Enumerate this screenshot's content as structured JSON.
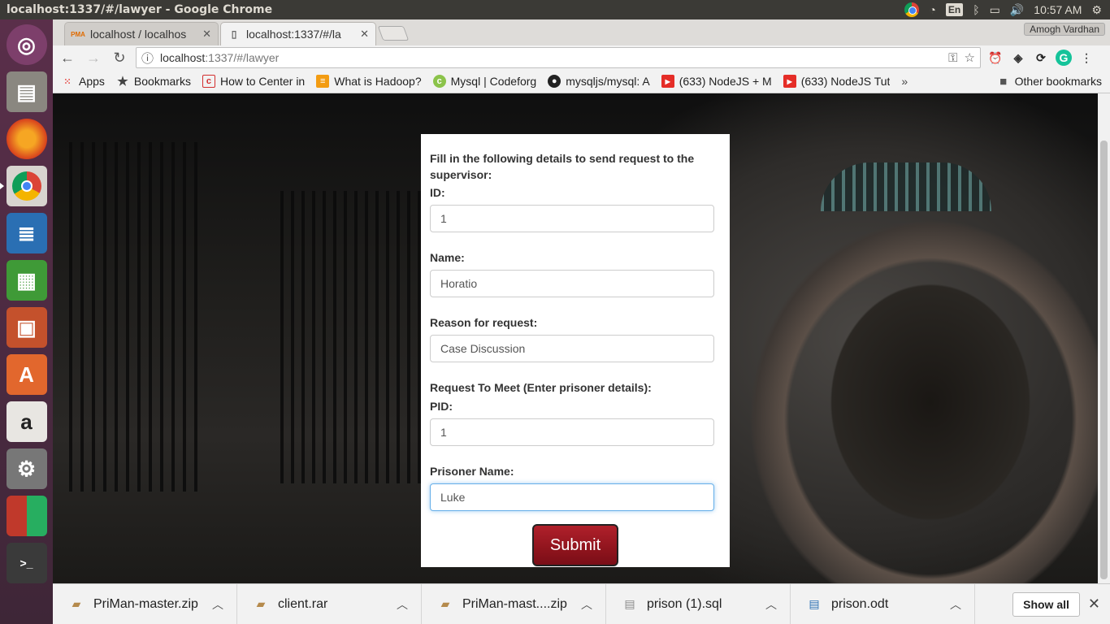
{
  "window": {
    "title": "localhost:1337/#/lawyer - Google Chrome"
  },
  "tray": {
    "lang": "En",
    "time": "10:57 AM"
  },
  "launcher": {
    "items": [
      "ubuntu-dash",
      "files",
      "firefox",
      "chrome",
      "writer",
      "calc",
      "impress",
      "software-center",
      "amazon",
      "system-settings",
      "workspace-switcher",
      "terminal"
    ]
  },
  "tabs": [
    {
      "title": "localhost / localhos",
      "favicon": "PMA"
    },
    {
      "title": "localhost:1337/#/la"
    }
  ],
  "profile": {
    "name": "Amogh Vardhan"
  },
  "omnibox": {
    "host": "localhost",
    "path": ":1337/#/lawyer"
  },
  "bookmarks": {
    "items": [
      {
        "label": "Apps",
        "icon": "apps-grid-icon"
      },
      {
        "label": "Bookmarks",
        "icon": "star-icon"
      },
      {
        "label": "How to Center in",
        "icon": "c-icon"
      },
      {
        "label": "What is Hadoop?",
        "icon": "hadoop-icon"
      },
      {
        "label": "Mysql | Codeforg",
        "icon": "codeforge-icon"
      },
      {
        "label": "mysqljs/mysql: A",
        "icon": "github-icon"
      },
      {
        "label": "(633) NodeJS + M",
        "icon": "youtube-icon"
      },
      {
        "label": "(633) NodeJS Tut",
        "icon": "youtube-icon"
      }
    ],
    "overflow": "»",
    "other": "Other bookmarks"
  },
  "form": {
    "heading": "Fill in the following details to send request to the supervisor:",
    "id_label": "ID:",
    "id_value": "1",
    "name_label": "Name:",
    "name_value": "Horatio",
    "reason_label": "Reason for request:",
    "reason_value": "Case Discussion",
    "meet_heading": "Request To Meet (Enter prisoner details):",
    "pid_label": "PID:",
    "pid_value": "1",
    "prisoner_name_label": "Prisoner Name:",
    "prisoner_name_value": "Luke",
    "submit_label": "Submit"
  },
  "downloads": {
    "items": [
      {
        "name": "PriMan-master.zip",
        "icon": "archive-icon"
      },
      {
        "name": "client.rar",
        "icon": "archive-icon"
      },
      {
        "name": "PriMan-mast....zip",
        "icon": "archive-icon"
      },
      {
        "name": "prison (1).sql",
        "icon": "text-file-icon"
      },
      {
        "name": "prison.odt",
        "icon": "document-icon"
      }
    ],
    "show_all": "Show all"
  }
}
